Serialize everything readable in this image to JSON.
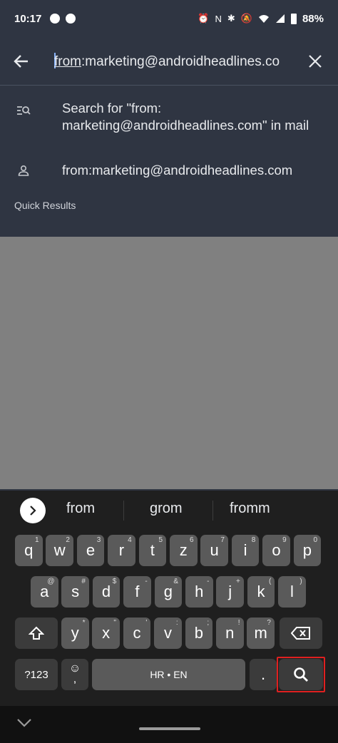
{
  "status_bar": {
    "time": "10:17",
    "battery": "88%",
    "icons": [
      "messenger-icon",
      "messenger-icon",
      "alarm-icon",
      "nfc-icon",
      "bluetooth-icon",
      "mute-icon",
      "wifi-icon",
      "signal-icon",
      "battery-icon"
    ]
  },
  "search": {
    "query_prefix": "from",
    "query_rest": ":marketing@androidheadlines.co",
    "suggestions": [
      {
        "icon": "search-in-mail-icon",
        "text": "Search for \"from: marketing@androidheadlines.com\" in mail"
      },
      {
        "icon": "person-icon",
        "text": "from:marketing@androidheadlines.com"
      }
    ],
    "quick_results_label": "Quick Results"
  },
  "keyboard": {
    "suggestions": [
      "from",
      "grom",
      "fromm"
    ],
    "row1": [
      {
        "k": "q",
        "h": "1"
      },
      {
        "k": "w",
        "h": "2"
      },
      {
        "k": "e",
        "h": "3"
      },
      {
        "k": "r",
        "h": "4"
      },
      {
        "k": "t",
        "h": "5"
      },
      {
        "k": "z",
        "h": "6"
      },
      {
        "k": "u",
        "h": "7"
      },
      {
        "k": "i",
        "h": "8"
      },
      {
        "k": "o",
        "h": "9"
      },
      {
        "k": "p",
        "h": "0"
      }
    ],
    "row2": [
      {
        "k": "a",
        "h": "@"
      },
      {
        "k": "s",
        "h": "#"
      },
      {
        "k": "d",
        "h": "$"
      },
      {
        "k": "f",
        "h": "-"
      },
      {
        "k": "g",
        "h": "&"
      },
      {
        "k": "h",
        "h": "-"
      },
      {
        "k": "j",
        "h": "+"
      },
      {
        "k": "k",
        "h": "("
      },
      {
        "k": "l",
        "h": ")"
      }
    ],
    "row3": [
      {
        "k": "y",
        "h": "*"
      },
      {
        "k": "x",
        "h": "\""
      },
      {
        "k": "c",
        "h": "'"
      },
      {
        "k": "v",
        "h": ":"
      },
      {
        "k": "b",
        "h": ";"
      },
      {
        "k": "n",
        "h": "!"
      },
      {
        "k": "m",
        "h": "?"
      }
    ],
    "symbols_label": "?123",
    "space_label": "HR • EN",
    "period_label": ".",
    "emoji_label": "☺"
  }
}
